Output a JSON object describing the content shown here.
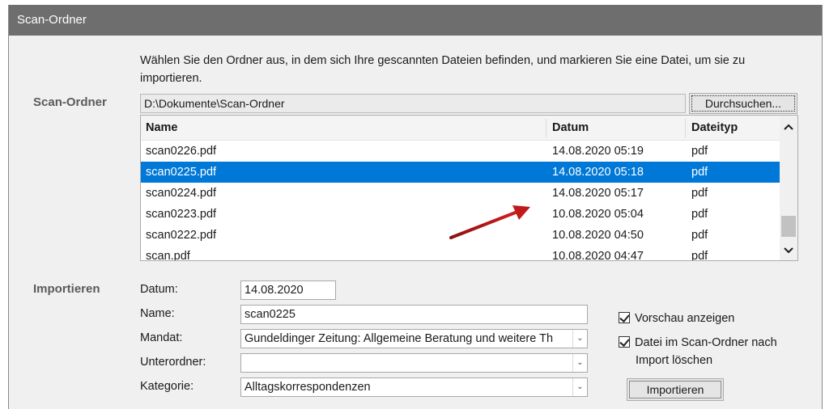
{
  "window": {
    "title": "Scan-Ordner"
  },
  "scan": {
    "description": "Wählen Sie den Ordner aus, in dem sich Ihre gescannten Dateien befinden, und markieren Sie eine Datei,  um sie zu importieren.",
    "section_label": "Scan-Ordner",
    "path": "D:\\Dokumente\\Scan-Ordner",
    "browse_label": "Durchsuchen..."
  },
  "file_list": {
    "columns": {
      "name": "Name",
      "date": "Datum",
      "type": "Dateityp"
    },
    "rows": [
      {
        "name": "scan0226.pdf",
        "date": "14.08.2020 05:19",
        "type": "pdf",
        "selected": false
      },
      {
        "name": "scan0225.pdf",
        "date": "14.08.2020 05:18",
        "type": "pdf",
        "selected": true
      },
      {
        "name": "scan0224.pdf",
        "date": "14.08.2020 05:17",
        "type": "pdf",
        "selected": false
      },
      {
        "name": "scan0223.pdf",
        "date": "10.08.2020 05:04",
        "type": "pdf",
        "selected": false
      },
      {
        "name": "scan0222.pdf",
        "date": "10.08.2020 04:50",
        "type": "pdf",
        "selected": false
      },
      {
        "name": "scan.pdf",
        "date": "10.08.2020 04:47",
        "type": "pdf",
        "selected": false
      }
    ],
    "selected_color": "#0078d7",
    "scroll_up_icon": "chevron-up-icon",
    "scroll_down_icon": "chevron-down-icon"
  },
  "annotation": {
    "arrow_color": "#c01a1a",
    "icon": "red-arrow-icon"
  },
  "import": {
    "section_label": "Importieren",
    "date_label": "Datum:",
    "date_value": "14.08.2020",
    "name_label": "Name:",
    "name_value": "scan0225",
    "mandate_label": "Mandat:",
    "mandate_value": "Gundeldinger Zeitung: Allgemeine Beratung und weitere Th",
    "subfolder_label": "Unterordner:",
    "subfolder_value": "",
    "category_label": "Kategorie:",
    "category_value": "Alltagskorrespondenzen",
    "preview_label": "Vorschau anzeigen",
    "preview_checked": true,
    "delete_label_line1": "Datei im Scan-Ordner nach",
    "delete_label_line2": "Import löschen",
    "delete_checked": true,
    "import_button": "Importieren"
  }
}
